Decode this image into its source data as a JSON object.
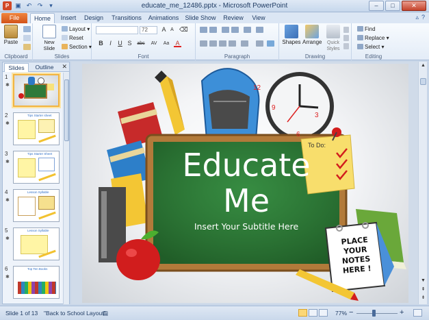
{
  "window": {
    "title": "educate_me_12486.pptx - Microsoft PowerPoint",
    "minimize": "–",
    "maximize": "□",
    "close": "✕"
  },
  "tabs": [
    {
      "label": "File"
    },
    {
      "label": "Home"
    },
    {
      "label": "Insert"
    },
    {
      "label": "Design"
    },
    {
      "label": "Transitions"
    },
    {
      "label": "Animations"
    },
    {
      "label": "Slide Show"
    },
    {
      "label": "Review"
    },
    {
      "label": "View"
    }
  ],
  "ribbon": {
    "clipboard": {
      "label": "Clipboard",
      "paste": "Paste"
    },
    "slides": {
      "label": "Slides",
      "new_slide": "New Slide",
      "layout": "Layout",
      "reset": "Reset",
      "section": "Section"
    },
    "font": {
      "label": "Font",
      "size": "72",
      "bold": "B",
      "italic": "I",
      "underline": "U",
      "strike": "S",
      "shadow": "abc",
      "spacing": "AV",
      "case": "Aa",
      "color": "A"
    },
    "paragraph": {
      "label": "Paragraph"
    },
    "drawing": {
      "label": "Drawing",
      "shapes": "Shapes",
      "arrange": "Arrange",
      "quick_styles": "Quick Styles"
    },
    "editing": {
      "label": "Editing",
      "find": "Find",
      "replace": "Replace",
      "select": "Select"
    }
  },
  "pane": {
    "tabs": {
      "slides": "Slides",
      "outline": "Outline"
    },
    "close": "✕",
    "thumbnails": [
      {
        "num": "1",
        "title": ""
      },
      {
        "num": "2",
        "title": "Tips Starter sheet"
      },
      {
        "num": "3",
        "title": "Tips Starter Sheet"
      },
      {
        "num": "4",
        "title": "Lesson Syllable"
      },
      {
        "num": "5",
        "title": "Lesson Syllable"
      },
      {
        "num": "6",
        "title": "Top Ten Books"
      }
    ]
  },
  "slide": {
    "title_line1": "Educate",
    "title_line2": "Me",
    "subtitle": "Insert Your Subtitle Here",
    "todo": "To Do:",
    "note_line1": "PLACE",
    "note_line2": "YOUR",
    "note_line3": "NOTES",
    "note_line4": "HERE !",
    "clock": {
      "n12": "12",
      "n3": "3",
      "n6": "6",
      "n9": "9"
    }
  },
  "status": {
    "slide_info": "Slide 1 of 13",
    "layout": "\"Back to School Layout\"",
    "zoom": "77%",
    "zoom_out": "−",
    "zoom_in": "+"
  }
}
